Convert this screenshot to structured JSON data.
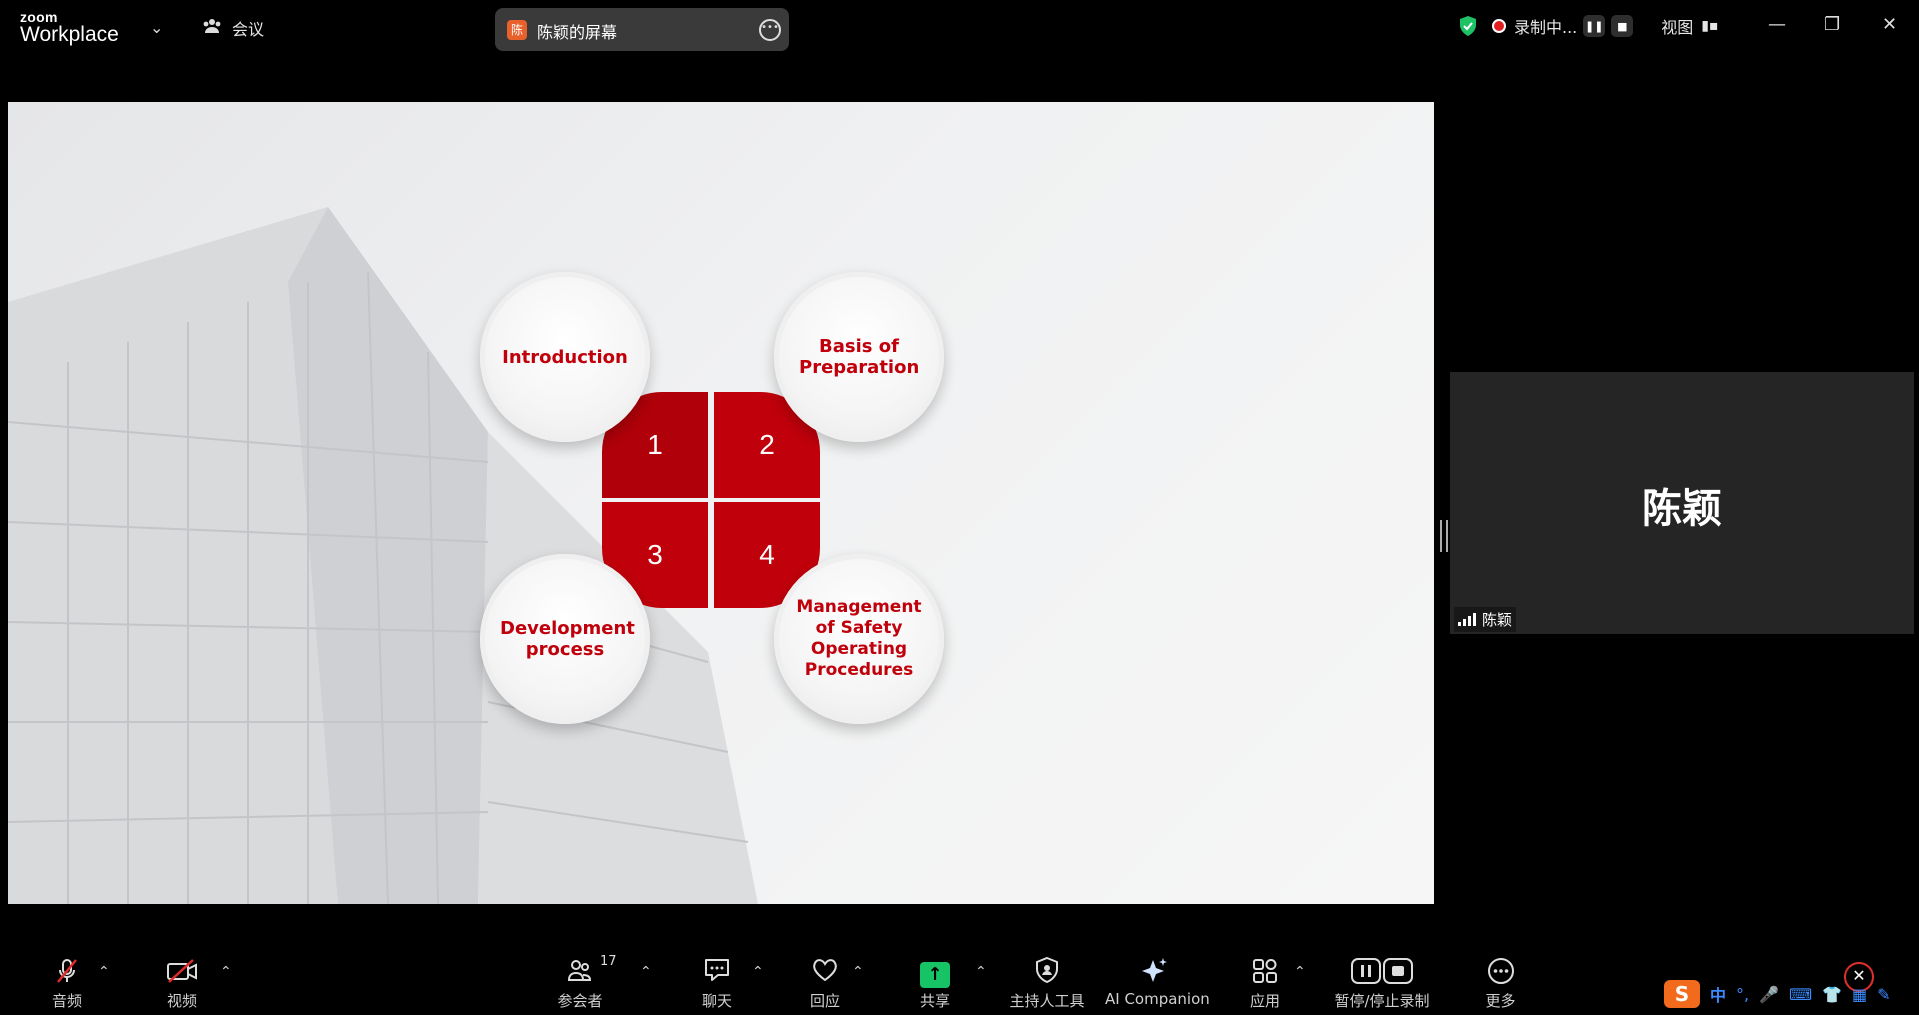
{
  "topbar": {
    "logo_top": "zoom",
    "logo_main": "Workplace",
    "meeting_label": "会议",
    "share_avatar": "陈",
    "share_label": "陈颖的屏幕",
    "recording_label": "录制中...",
    "view_label": "视图"
  },
  "slide": {
    "petals": [
      "1",
      "2",
      "3",
      "4"
    ],
    "circles": [
      "Introduction",
      "Basis of Preparation",
      "Development process",
      "Management of Safety Operating Procedures"
    ],
    "accent": "#c0000b"
  },
  "participant_tile": {
    "big_name": "陈颖",
    "small_name": "陈颖"
  },
  "toolbar": {
    "audio": "音频",
    "video": "视频",
    "participants": "参会者",
    "participant_count": "17",
    "chat": "聊天",
    "react": "回应",
    "share": "共享",
    "host_tools": "主持人工具",
    "ai": "AI Companion",
    "apps": "应用",
    "record": "暂停/停止录制",
    "more": "更多"
  },
  "tray": {
    "ime": "中"
  }
}
